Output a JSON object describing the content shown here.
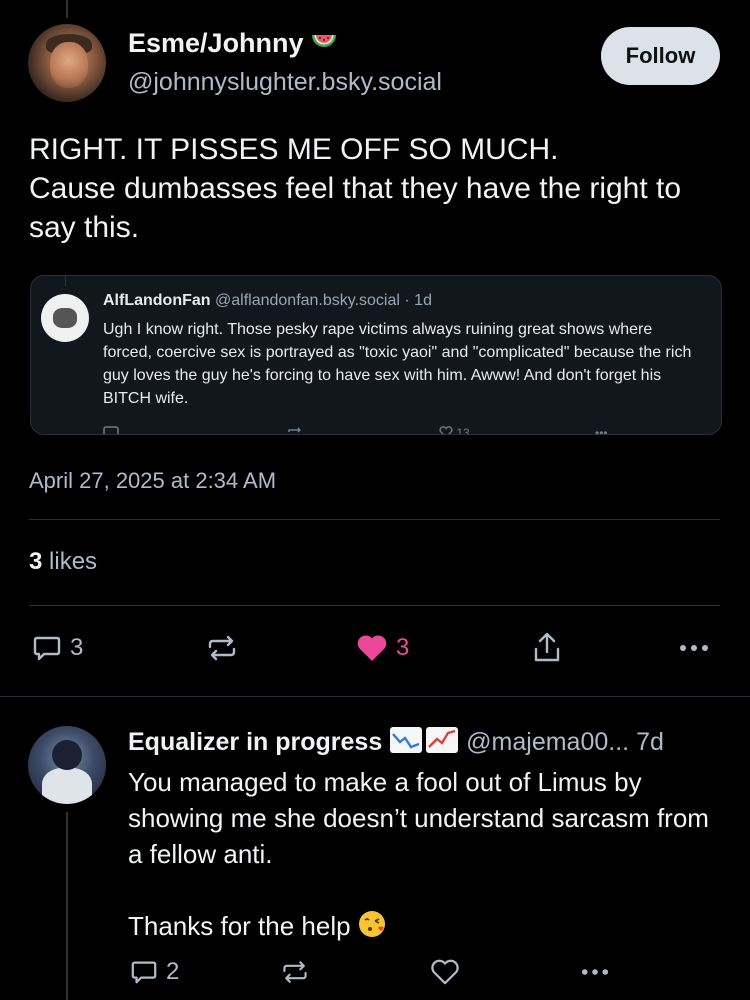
{
  "post": {
    "author": {
      "display_name": "Esme/Johnny",
      "handle": "@johnnyslughter.bsky.social",
      "name_emoji": "watermelon"
    },
    "follow_label": "Follow",
    "text": "RIGHT. IT PISSES ME OFF SO MUCH.\nCause dumbasses feel that they have the right to say this.",
    "quote": {
      "display_name": "AlfLandonFan",
      "handle": "@alflandonfan.bsky.social",
      "time": "· 1d",
      "text": "Ugh I know right. Those pesky rape victims always ruining great shows where forced, coercive sex is portrayed as \"toxic yaoi\" and \"complicated\" because the rich guy loves the guy he's forcing to have sex with him. Awww! And don't forget his BITCH wife.",
      "like_count": "13"
    },
    "timestamp": "April 27, 2025 at 2:34 AM",
    "likes_count": "3",
    "likes_label": "likes",
    "actions": {
      "reply_count": "3",
      "like_count": "3",
      "liked_color": "#ec4899"
    }
  },
  "reply": {
    "display_name": "Equalizer in progress",
    "name_emoji": "chart-icons",
    "handle": "@majema00...",
    "time": "7d",
    "text": "You managed to make a fool out of Limus by showing me she doesn’t understand sarcasm from a fellow anti.\n\nThanks for the help",
    "text_emoji": "face-blowing-kiss",
    "reply_count": "2"
  }
}
